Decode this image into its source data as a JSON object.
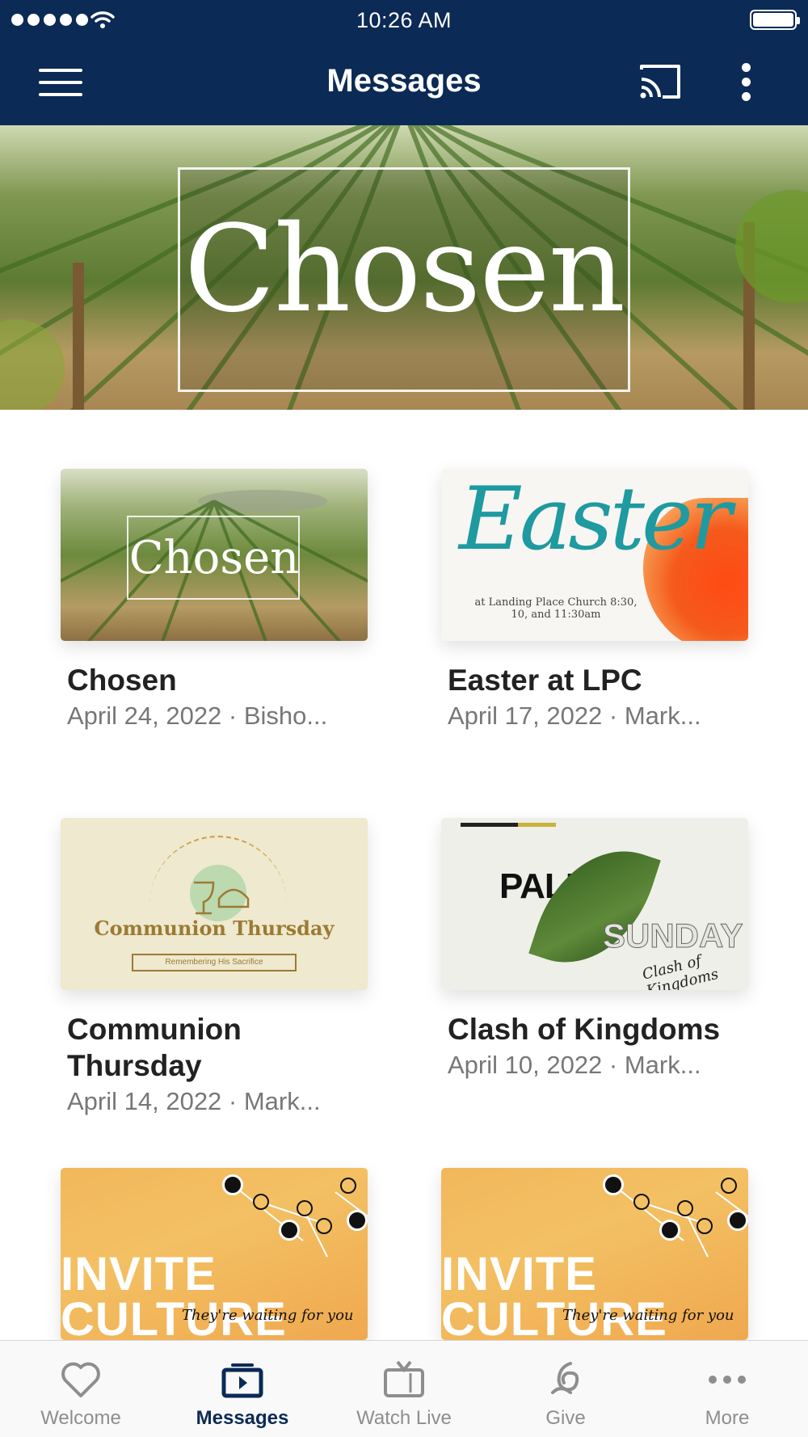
{
  "status_bar": {
    "time": "10:26 AM"
  },
  "header": {
    "title": "Messages"
  },
  "hero": {
    "title": "Chosen"
  },
  "messages": [
    {
      "title": "Chosen",
      "subtitle": "April 24, 2022 · Bisho...",
      "thumb_text": "Chosen"
    },
    {
      "title": "Easter at LPC",
      "subtitle": "April 17, 2022 · Mark...",
      "thumb_text": "Easter",
      "thumb_tagline": "at Landing Place Church 8:30, 10, and 11:30am"
    },
    {
      "title": "Communion Thursday",
      "subtitle": "April 14, 2022 · Mark...",
      "thumb_text": "Communion Thursday",
      "thumb_tagline": "Remembering His Sacrifice"
    },
    {
      "title": "Clash of Kingdoms",
      "subtitle": "April 10, 2022 · Mark...",
      "thumb_text": "PALM",
      "thumb_text2": "SUNDAY",
      "thumb_tagline": "Clash of Kingdoms"
    },
    {
      "thumb_text": "INVITE CULTURE",
      "thumb_tagline": "They're waiting for you",
      "thumb_badge": "invite"
    },
    {
      "thumb_text": "INVITE CULTURE",
      "thumb_tagline": "They're waiting for you",
      "thumb_badge": "invite"
    }
  ],
  "tabs": [
    {
      "label": "Welcome",
      "icon": "heart-icon",
      "active": false
    },
    {
      "label": "Messages",
      "icon": "play-video-icon",
      "active": true
    },
    {
      "label": "Watch Live",
      "icon": "tv-icon",
      "active": false
    },
    {
      "label": "Give",
      "icon": "give-icon",
      "active": false
    },
    {
      "label": "More",
      "icon": "more-dots-icon",
      "active": false
    }
  ],
  "colors": {
    "header_bg": "#0b2a55",
    "active_tab": "#0b2a55",
    "inactive_tab": "#8e8e8e"
  }
}
